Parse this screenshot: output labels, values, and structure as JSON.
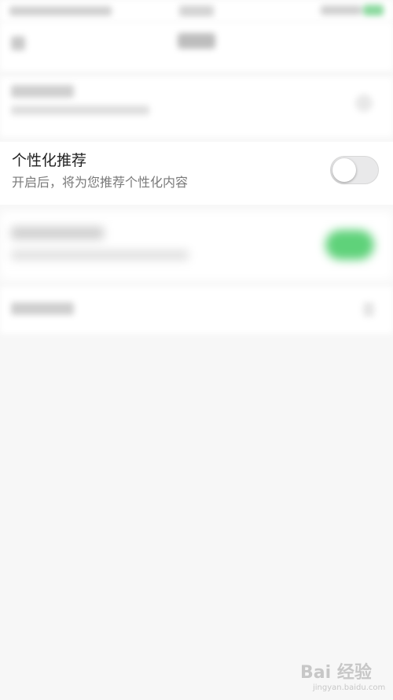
{
  "setting": {
    "title": "个性化推荐",
    "subtitle": "开启后，将为您推荐个性化内容",
    "toggle_on": false
  },
  "watermark": {
    "brand": "Bai 经验",
    "url": "jingyan.baidu.com"
  },
  "colors": {
    "background": "#f7f7f7",
    "toggle_off": "#e9e9ea",
    "toggle_on_blurred": "#5fd27a"
  },
  "icons": {
    "back": "back-arrow-icon",
    "chevron": "chevron-right-icon"
  }
}
